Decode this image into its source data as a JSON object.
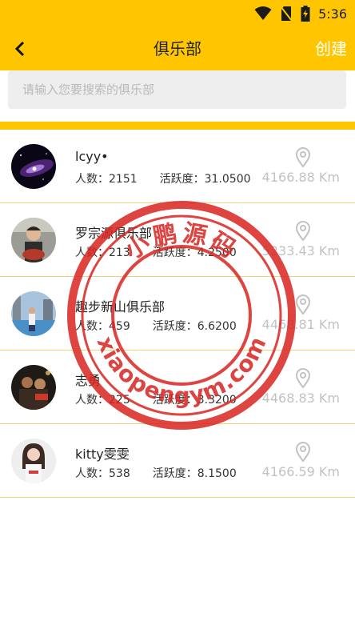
{
  "status_bar": {
    "time": "5:36",
    "icons": [
      "wifi-icon",
      "no-sim-icon",
      "battery-icon"
    ]
  },
  "header": {
    "title": "俱乐部",
    "create_label": "创建",
    "back_icon": "chevron-left-icon"
  },
  "search": {
    "placeholder": "请输入您要搜索的俱乐部",
    "value": ""
  },
  "clubs": [
    {
      "name": "lcyy•",
      "members_label": "人数：2151",
      "activity_label": "活跃度：31.0500",
      "distance": "4166.88 Km"
    },
    {
      "name": "罗宗源俱乐部",
      "members_label": "人数：213",
      "activity_label": "活跃度：4.2500",
      "distance": "5233.43 Km"
    },
    {
      "name": "趣步新山俱乐部",
      "members_label": "人数：459",
      "activity_label": "活跃度：6.6200",
      "distance": "4468.81 Km"
    },
    {
      "name": "志勇",
      "members_label": "人数：225",
      "activity_label": "活跃度：3.3200",
      "distance": "4468.83 Km"
    },
    {
      "name": "kitty雯雯",
      "members_label": "人数：538",
      "activity_label": "活跃度：8.1500",
      "distance": "4166.59 Km"
    }
  ],
  "watermark": {
    "top_text": "小鹏源码",
    "bottom_text": "xiaopengym.com"
  },
  "colors": {
    "accent": "#ffc600",
    "divider": "#f0d27a",
    "muted_text": "#c2c2c2",
    "watermark": "#d8231f"
  }
}
